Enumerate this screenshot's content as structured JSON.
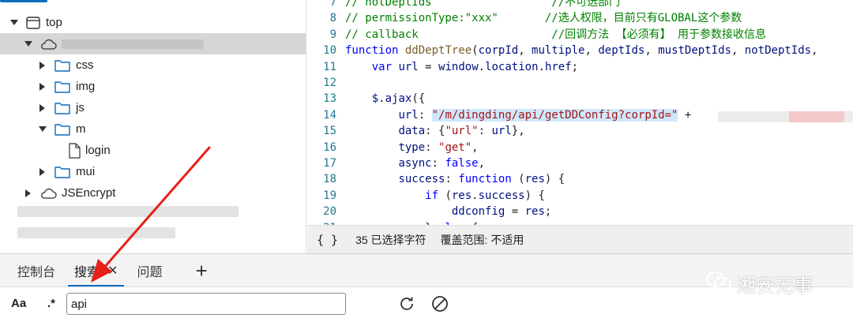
{
  "colors": {
    "accent": "#0f6cbd",
    "selected_row": "#d6d6d6",
    "annotation_arrow": "#e8201a",
    "keyword": "#0000ff",
    "comment": "#008000",
    "string": "#a31515",
    "selection_highlight": "#cfe8fc"
  },
  "tree": {
    "items": [
      {
        "label": "top",
        "icon": "window-icon",
        "expanded": true
      },
      {
        "label": "",
        "icon": "cloud-icon",
        "expanded": true,
        "selected": true
      },
      {
        "label": "css",
        "icon": "folder-icon",
        "expanded": false
      },
      {
        "label": "img",
        "icon": "folder-icon",
        "expanded": false
      },
      {
        "label": "js",
        "icon": "folder-icon",
        "expanded": false
      },
      {
        "label": "m",
        "icon": "folder-icon",
        "expanded": true
      },
      {
        "label": "login",
        "icon": "file-icon"
      },
      {
        "label": "mui",
        "icon": "folder-icon",
        "expanded": false
      },
      {
        "label": "JSEncrypt",
        "icon": "cloud-icon",
        "expanded": false
      }
    ]
  },
  "editor": {
    "lines": [
      {
        "n": "7",
        "text": "// notDeptIds                  //不可选部门"
      },
      {
        "n": "8",
        "text": "// permissionType:\"xxx\"       //选人权限，目前只有GLOBAL这个参数"
      },
      {
        "n": "9",
        "text": "// callback                    //回调方法 【必须有】 用于参数接收信息"
      },
      {
        "n": "10",
        "text": "function ddDeptTree(corpId, multiple, deptIds, mustDeptIds, notDeptIds, "
      },
      {
        "n": "11",
        "text": "    var url = window.location.href;"
      },
      {
        "n": "12",
        "text": ""
      },
      {
        "n": "13",
        "text": "    $.ajax({"
      },
      {
        "n": "14",
        "text": "        url: \"/m/dingding/api/getDDConfig?corpId=\" +"
      },
      {
        "n": "15",
        "text": "        data: {\"url\": url},"
      },
      {
        "n": "16",
        "text": "        type: \"get\","
      },
      {
        "n": "17",
        "text": "        async: false,"
      },
      {
        "n": "18",
        "text": "        success: function (res) {"
      },
      {
        "n": "19",
        "text": "            if (res.success) {"
      },
      {
        "n": "20",
        "text": "                ddconfig = res;"
      },
      {
        "n": "21",
        "text": "            } else {"
      }
    ]
  },
  "statusbar": {
    "braces": "{ }",
    "selection": "35 已选择字符",
    "coverage": "覆盖范围: 不适用"
  },
  "tabs": {
    "items": [
      {
        "label": "控制台",
        "active": false
      },
      {
        "label": "搜索",
        "active": true,
        "close": "✕"
      },
      {
        "label": "问题",
        "active": false
      }
    ],
    "add": "+"
  },
  "search": {
    "case_toggle": "Aa",
    "regex_toggle": ".*",
    "value": "api",
    "refresh_icon": "refresh-icon",
    "clear_icon": "clear-icon"
  },
  "watermark": {
    "text": "湘安无事",
    "icon": "wechat-icon"
  }
}
